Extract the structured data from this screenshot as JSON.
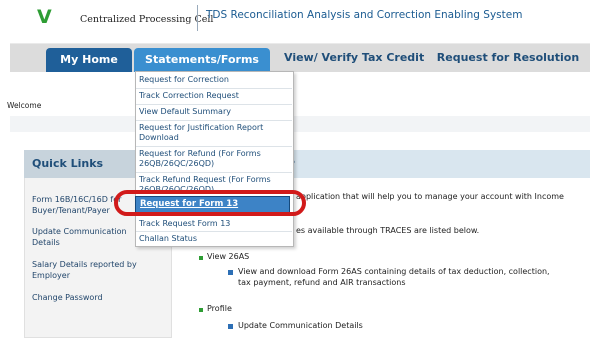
{
  "header": {
    "logo": "V",
    "org_name": "Centralized Processing Cell",
    "system_title": "TDS Reconciliation Analysis and Correction Enabling System"
  },
  "nav": {
    "home": "My Home",
    "statements": "Statements/Forms",
    "view_verify": "View/ Verify Tax Credit",
    "resolution": "Request for Resolution"
  },
  "welcome": "Welcome",
  "dropdown": {
    "items": [
      "Request for Correction",
      "Track Correction Request",
      "View Default Summary",
      "Request for Justification Report",
      "Download",
      "Request for Refund (For Forms",
      "26QB/26QC/26QD)",
      "Track Refund Request (For Forms",
      "26QB/26QC/26QD)",
      "Request for Form 13",
      "Track Request Form 13",
      "Challan Status"
    ]
  },
  "quick_links": {
    "title": "Quick Links",
    "items": [
      "Form 16B/16C/16D for",
      "Buyer/Tenant/Payer",
      "Update Communication",
      "Details",
      "Salary Details reported by",
      "Employer",
      "Change Password"
    ]
  },
  "main": {
    "header_fragment": "S",
    "intro_line1": "application that will help you to manage your account with Income",
    "intro_line2": "es available through TRACES are listed below.",
    "section1": "View 26AS",
    "section1_desc1": "View and download Form 26AS containing details of tax deduction, collection,",
    "section1_desc2": "tax payment, refund and AIR transactions",
    "section2": "Profile",
    "section2_item": "Update Communication Details"
  },
  "colors": {
    "brand_green": "#2e9d34",
    "nav_dark_blue": "#1f5f99",
    "nav_active_blue": "#3a8fd0",
    "highlight_red": "#d11a1a"
  }
}
